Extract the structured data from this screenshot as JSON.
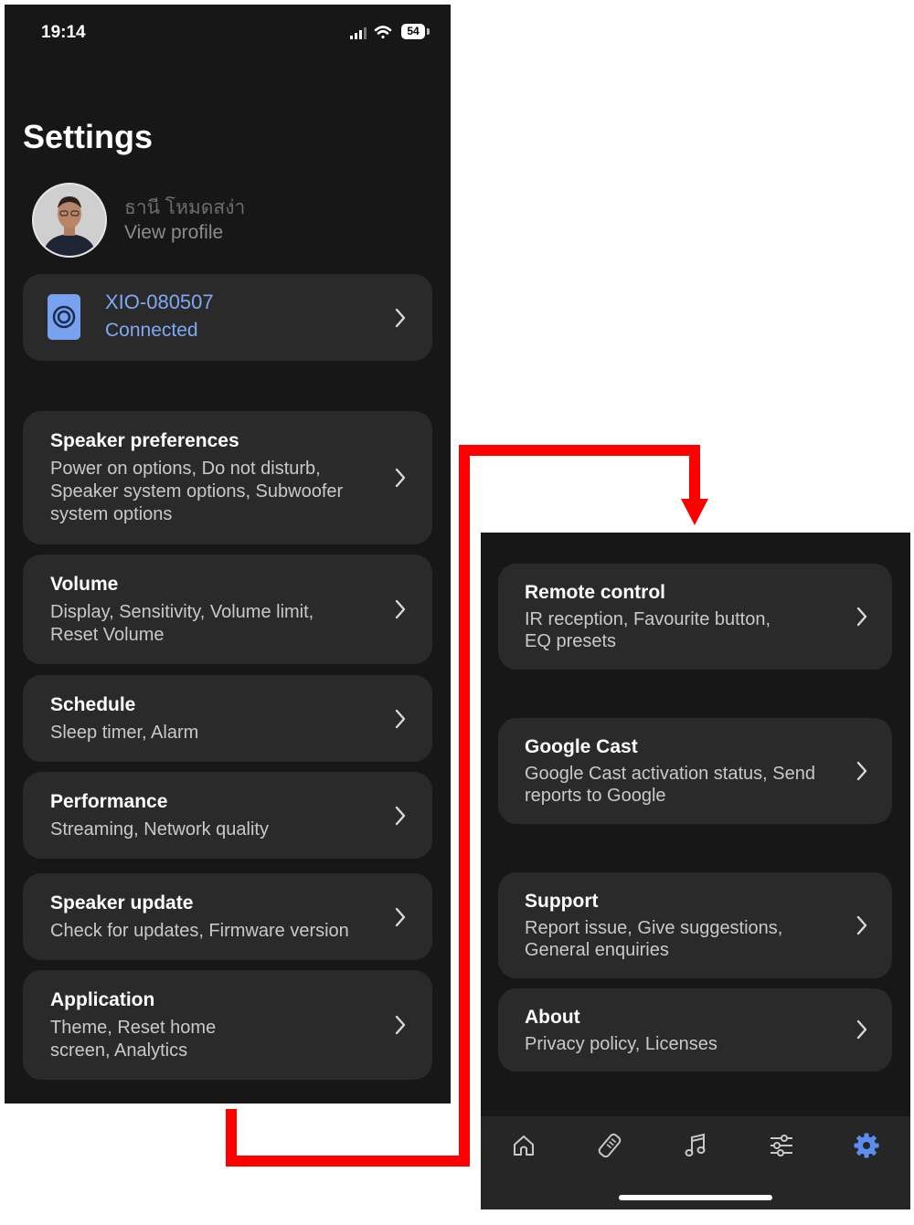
{
  "status_bar": {
    "time": "19:14",
    "battery": "54"
  },
  "header": {
    "title": "Settings"
  },
  "profile": {
    "name": "ธานี โหมดสง่า",
    "link": "View profile"
  },
  "device": {
    "name": "XIO-080507",
    "status": "Connected"
  },
  "settings_items": [
    {
      "title": "Speaker preferences",
      "lines": [
        "Power on options, Do not disturb,",
        "Speaker system options, Subwoofer",
        "system options"
      ]
    },
    {
      "title": "Volume",
      "lines": [
        "Display, Sensitivity, Volume limit,",
        "Reset Volume"
      ]
    },
    {
      "title": "Schedule",
      "lines": [
        "Sleep timer, Alarm"
      ]
    },
    {
      "title": "Performance",
      "lines": [
        "Streaming, Network quality"
      ]
    },
    {
      "title": "Speaker update",
      "lines": [
        "Check for updates, Firmware version"
      ]
    },
    {
      "title": "Application",
      "lines": [
        "Theme, Reset home",
        "screen, Analytics"
      ]
    },
    {
      "title": "Remote control",
      "lines": [
        "IR reception, Favourite button,",
        "EQ presets"
      ]
    },
    {
      "title": "Google Cast",
      "lines": [
        "Google Cast activation status, Send",
        "reports to Google"
      ]
    },
    {
      "title": "Support",
      "lines": [
        "Report issue, Give suggestions,",
        "General enquiries"
      ]
    },
    {
      "title": "About",
      "lines": [
        "Privacy policy, Licenses"
      ]
    }
  ],
  "tab_bar": {
    "tabs": [
      {
        "icon": "home-icon"
      },
      {
        "icon": "remote-icon"
      },
      {
        "icon": "music-note-icon"
      },
      {
        "icon": "sliders-icon"
      },
      {
        "icon": "gear-icon",
        "active": true
      }
    ],
    "active_color": "#5b8ef0",
    "inactive_color": "#c8c8c8"
  },
  "colors": {
    "accent": "#7fa8f5",
    "background": "#171717",
    "card": "#2a2a2a",
    "connector": "#ff0000"
  }
}
